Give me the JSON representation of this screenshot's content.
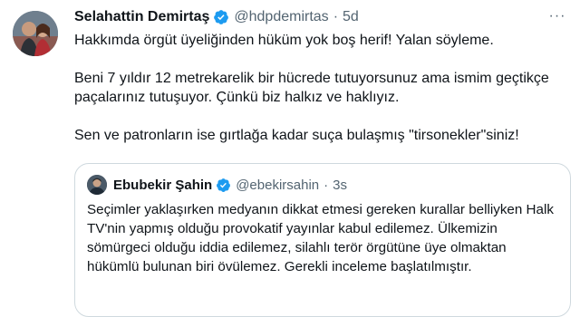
{
  "tweet": {
    "author": {
      "display_name": "Selahattin Demirtaş",
      "handle": "@hdpdemirtas",
      "separator": "·",
      "time": "5d",
      "verified_icon": "verified-badge-icon",
      "avatar": "profile-photo"
    },
    "more_icon": "more-horizontal-icon",
    "more_label": "···",
    "paragraphs": [
      "Hakkımda örgüt üyeliğinden hüküm yok boş herif! Yalan söyleme.",
      "Beni 7 yıldır 12 metrekarelik bir hücrede tutuyorsunuz ama ismim geçtikçe paçalarınız tutuşuyor. Çünkü biz halkız ve haklıyız.",
      "Sen ve patronların ise gırtlağa kadar suça bulaşmış \"tirsonekler\"siniz!"
    ]
  },
  "quoted_tweet": {
    "author": {
      "display_name": "Ebubekir Şahin",
      "handle": "@ebekirsahin",
      "separator": "·",
      "time": "3s",
      "verified_icon": "verified-badge-icon",
      "avatar": "profile-photo"
    },
    "text": "Seçimler yaklaşırken medyanın dikkat etmesi gereken kurallar belliyken Halk TV'nin yapmış olduğu provokatif yayınlar kabul edilemez. Ülkemizin sömürgeci olduğu iddia edilemez, silahlı terör örgütüne üye olmaktan hükümlü bulunan biri övülemez. Gerekli inceleme başlatılmıştır."
  },
  "colors": {
    "text": "#0f1419",
    "secondary_text": "#536471",
    "verified_blue": "#1d9bf0",
    "border": "#cfd9de",
    "background": "#ffffff"
  }
}
